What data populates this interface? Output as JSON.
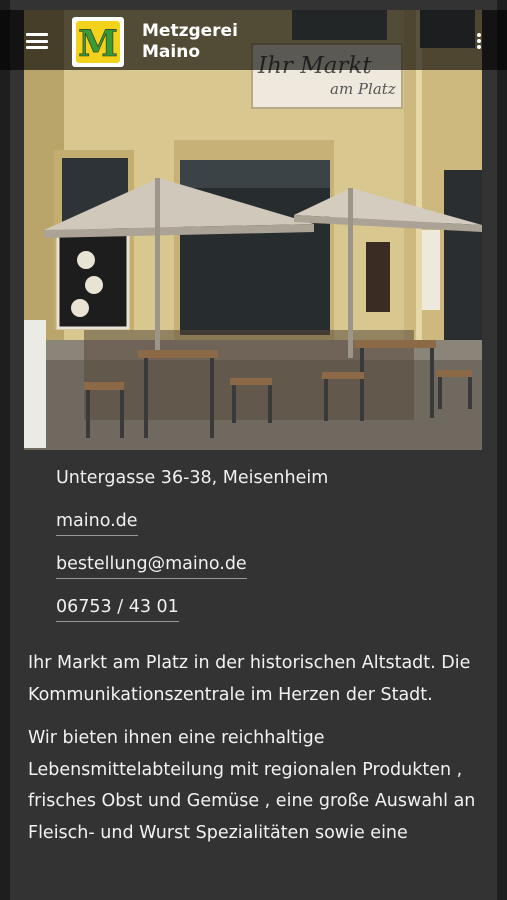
{
  "header": {
    "brand_line1": "Metzgerei",
    "brand_line2": "Maino",
    "logo_letter": "M",
    "menu_icon": "hamburger-menu-icon",
    "more_icon": "more-vertical-icon"
  },
  "hero": {
    "sign_line1": "Ihr Markt",
    "sign_line2": "am Platz"
  },
  "contact": {
    "address": "Untergasse 36-38, Meisenheim",
    "website": "maino.de",
    "email": "bestellung@maino.de",
    "phone": "06753 / 43 01"
  },
  "description": {
    "paragraph1": "Ihr Markt am Platz in der historischen Altstadt. Die Kommunikationszentrale im Herzen der Stadt.",
    "paragraph2": "Wir bieten ihnen eine reichhaltige Lebensmittelabteilung mit regionalen Produkten , frisches Obst und Gemüse , eine große Auswahl an Fleisch- und Wurst Spezialitäten sowie eine"
  },
  "colors": {
    "background": "#1e1e1e",
    "card": "#333333",
    "logo_yellow": "#f2d21b",
    "logo_green": "#3a9a34"
  }
}
